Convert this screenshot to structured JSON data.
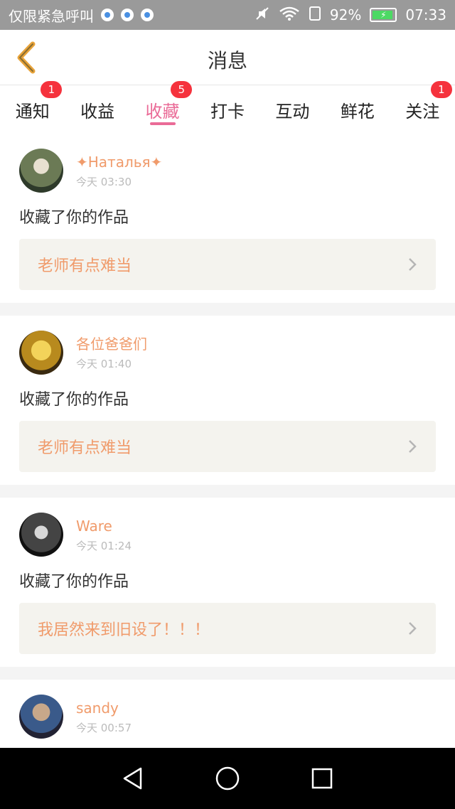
{
  "status_bar": {
    "carrier": "仅限紧急呼叫",
    "battery": "92%",
    "time": "07:33",
    "battery_color": "#4cd964"
  },
  "header": {
    "title": "消息",
    "back_icon": "chevron-left-icon",
    "accent": "#e8a33a"
  },
  "tabs": [
    {
      "label": "通知",
      "badge": "1",
      "active": false
    },
    {
      "label": "收益",
      "badge": "",
      "active": false
    },
    {
      "label": "收藏",
      "badge": "5",
      "active": true
    },
    {
      "label": "打卡",
      "badge": "",
      "active": false
    },
    {
      "label": "互动",
      "badge": "",
      "active": false
    },
    {
      "label": "鲜花",
      "badge": "",
      "active": false
    },
    {
      "label": "关注",
      "badge": "1",
      "active": false
    }
  ],
  "colors": {
    "active_tab": "#ea6b97",
    "badge": "#f5323d",
    "username": "#f09b6b",
    "work_bg": "#f4f3ee"
  },
  "feed": [
    {
      "username": "✦Наталья✦",
      "time": "今天 03:30",
      "action": "收藏了你的作品",
      "work_title": "老师有点难当"
    },
    {
      "username": "各位爸爸们",
      "time": "今天 01:40",
      "action": "收藏了你的作品",
      "work_title": "老师有点难当"
    },
    {
      "username": "Ware",
      "time": "今天 01:24",
      "action": "收藏了你的作品",
      "work_title": "我居然来到旧设了！！！"
    },
    {
      "username": "sandy",
      "time": "今天 00:57",
      "action": "",
      "work_title": ""
    }
  ]
}
